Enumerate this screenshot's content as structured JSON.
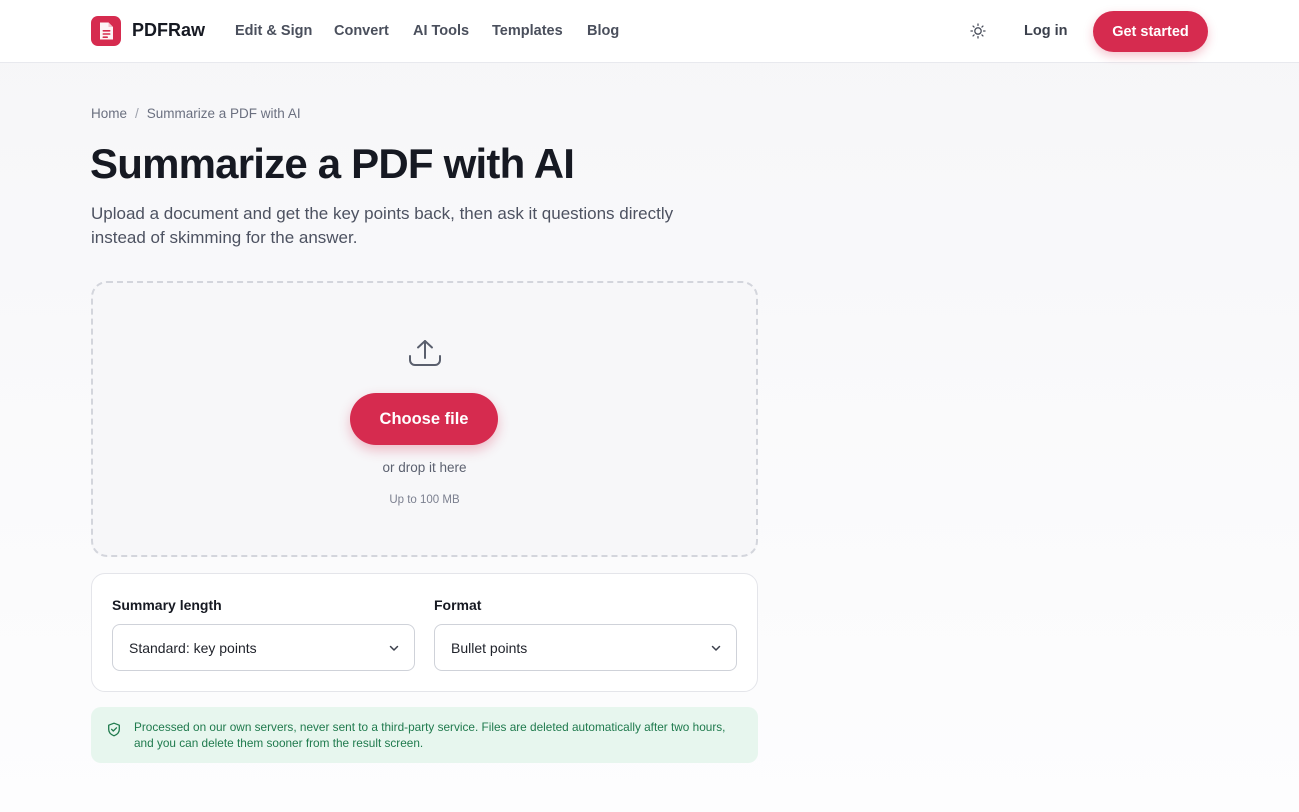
{
  "header": {
    "brand": "PDFRaw",
    "nav": [
      "Edit & Sign",
      "Convert",
      "AI Tools",
      "Templates",
      "Blog"
    ],
    "login_label": "Log in",
    "cta_label": "Get started"
  },
  "breadcrumb": {
    "home": "Home",
    "separator": "/",
    "current": "Summarize a PDF with AI"
  },
  "page": {
    "title": "Summarize a PDF with AI",
    "subtitle": "Upload a document and get the key points back, then ask it questions directly instead of skimming for the answer."
  },
  "upload": {
    "button_label": "Choose file",
    "drop_hint": "or drop it here",
    "size_limit": "Up to 100 MB"
  },
  "options": {
    "length_label": "Summary length",
    "length_value": "Standard: key points",
    "format_label": "Format",
    "format_value": "Bullet points"
  },
  "privacy": {
    "text": "Processed on our own servers, never sent to a third-party service. Files are deleted automatically after two hours, and you can delete them sooner from the result screen."
  },
  "icons": {
    "logo": "document-icon",
    "theme": "sun-icon",
    "upload": "upload-icon",
    "select": "chevron-down-icon",
    "privacy": "shield-check-icon"
  },
  "colors": {
    "accent": "#d62b4f",
    "success_bg": "#e7f6ee",
    "success_text": "#1f7a4d"
  }
}
